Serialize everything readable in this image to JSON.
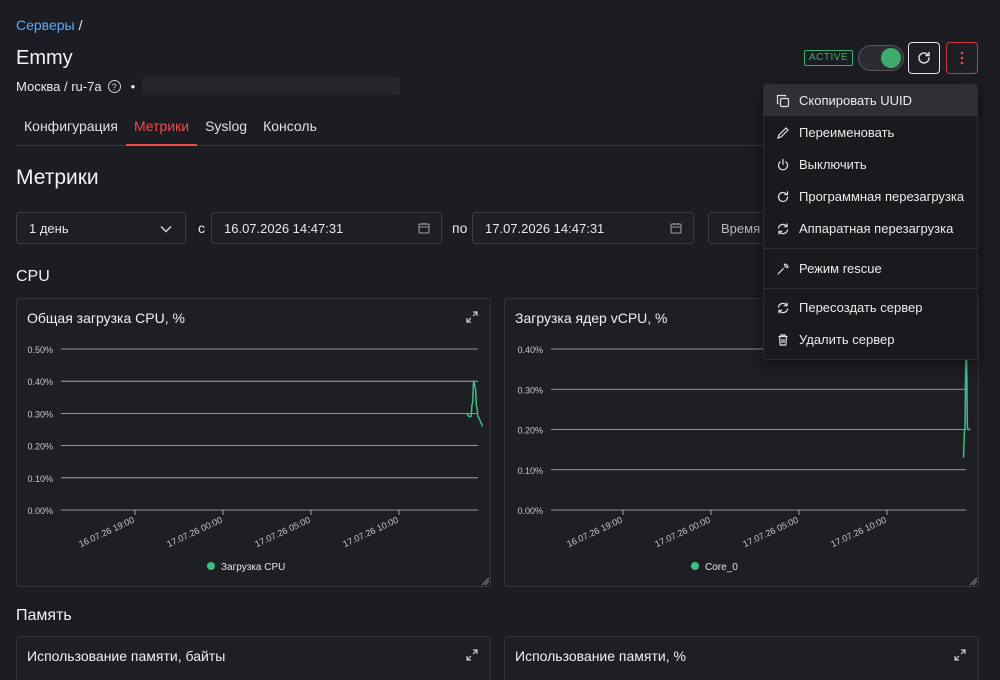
{
  "breadcrumb": {
    "link": "Серверы",
    "sep": "/"
  },
  "server": {
    "name": "Emmy",
    "location": "Москва / ru-7a",
    "status": "ACTIVE",
    "power_on": true
  },
  "tabs": [
    {
      "label": "Конфигурация"
    },
    {
      "label": "Метрики",
      "active": true
    },
    {
      "label": "Syslog"
    },
    {
      "label": "Консоль"
    }
  ],
  "metrics": {
    "title": "Метрики",
    "period": "1 день",
    "from_label": "с",
    "from": "16.07.2026 14:47:31",
    "to_label": "по",
    "to": "17.07.2026 14:47:31",
    "time_select": "Время"
  },
  "sections": {
    "cpu": "CPU",
    "memory": "Память"
  },
  "cards": {
    "cpu_total": "Общая загрузка CPU, %",
    "cpu_cores": "Загрузка ядер vCPU, %",
    "mem_bytes": "Использование памяти, байты",
    "mem_percent": "Использование памяти, %"
  },
  "menu": [
    {
      "label": "Скопировать UUID",
      "icon": "copy-icon"
    },
    {
      "label": "Переименовать",
      "icon": "pencil-icon"
    },
    {
      "label": "Выключить",
      "icon": "power-icon"
    },
    {
      "label": "Программная перезагрузка",
      "icon": "soft-reboot-icon"
    },
    {
      "label": "Аппаратная перезагрузка",
      "icon": "hard-reboot-icon"
    },
    {
      "label": "Режим rescue",
      "icon": "wrench-icon"
    },
    {
      "label": "Пересоздать сервер",
      "icon": "rebuild-icon"
    },
    {
      "label": "Удалить сервер",
      "icon": "trash-icon"
    }
  ],
  "colors": {
    "accent": "#ef4a4a",
    "link": "#5aa9ff",
    "series": "#3fbf7f",
    "active": "#3fae6a"
  },
  "chart_data": [
    {
      "type": "line",
      "title": "Общая загрузка CPU, %",
      "ylim": [
        0,
        0.5
      ],
      "y_ticks": [
        "0.00%",
        "0.10%",
        "0.20%",
        "0.30%",
        "0.40%",
        "0.50%"
      ],
      "x_ticks": [
        "16.07.26 19:00",
        "17.07.26 00:00",
        "17.07.26 05:00",
        "17.07.26 10:00"
      ],
      "series": [
        {
          "name": "Загрузка CPU",
          "x": [
            "17.07.26 13:50",
            "17.07.26 14:00",
            "17.07.26 14:05",
            "17.07.26 14:10",
            "17.07.26 14:15",
            "17.07.26 14:20",
            "17.07.26 14:25",
            "17.07.26 14:30",
            "17.07.26 14:35",
            "17.07.26 14:40",
            "17.07.26 14:45"
          ],
          "values": [
            0.3,
            0.29,
            0.29,
            0.33,
            0.4,
            0.38,
            0.32,
            0.29,
            0.28,
            0.27,
            0.26
          ]
        }
      ]
    },
    {
      "type": "line",
      "title": "Загрузка ядер vCPU, %",
      "ylim": [
        0,
        0.4
      ],
      "y_ticks": [
        "0.00%",
        "0.10%",
        "0.20%",
        "0.30%",
        "0.40%"
      ],
      "x_ticks": [
        "16.07.26 19:00",
        "17.07.26 00:00",
        "17.07.26 05:00",
        "17.07.26 10:00"
      ],
      "series": [
        {
          "name": "Core_0",
          "x": [
            "17.07.26 14:20",
            "17.07.26 14:25",
            "17.07.26 14:30",
            "17.07.26 14:35",
            "17.07.26 14:40",
            "17.07.26 14:45"
          ],
          "values": [
            0.13,
            0.2,
            0.42,
            0.2,
            0.2,
            0.2
          ]
        }
      ]
    }
  ]
}
